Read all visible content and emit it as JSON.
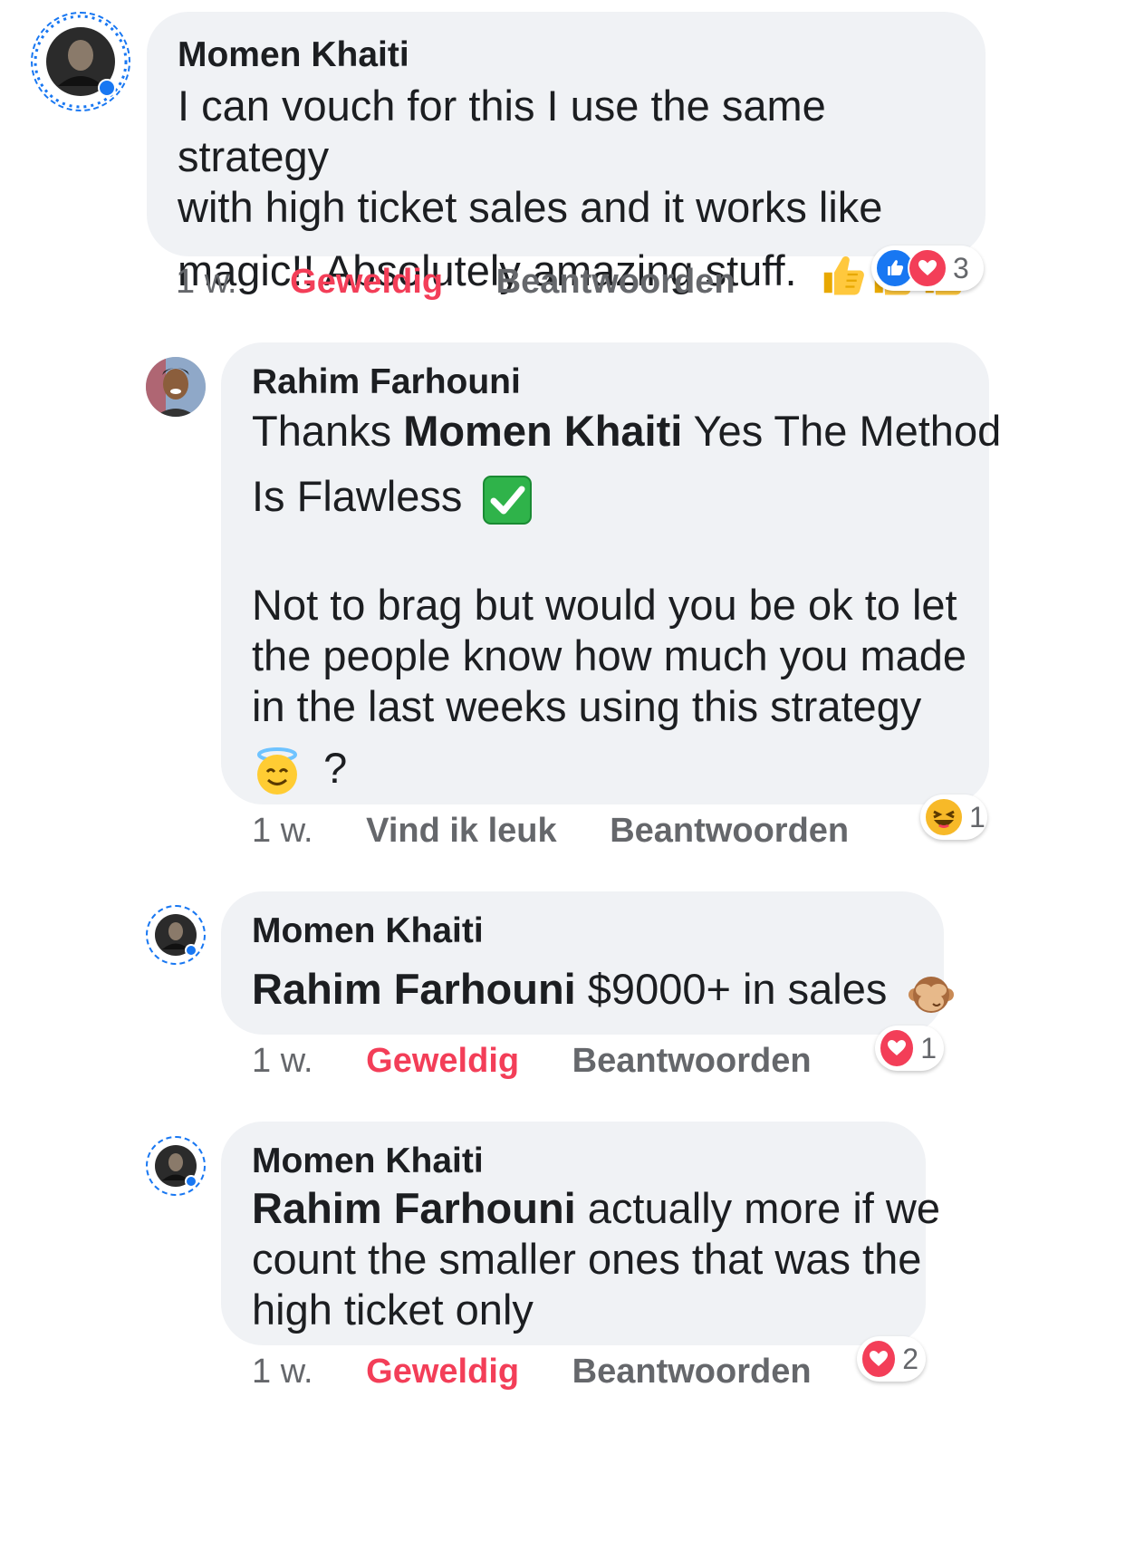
{
  "comments": [
    {
      "author": "Momen Khaiti",
      "lines": [
        "I can vouch for this I use the same strategy",
        "with high ticket sales and it works like",
        "magic!! Absolutely amazing stuff."
      ],
      "emoji": [
        "thumbs-up-emoji",
        "thumbs-up-emoji",
        "thumbs-up-emoji"
      ],
      "time": "1 w.",
      "reaction_label": "Geweldig",
      "reply_label": "Beantwoorden",
      "reaction_summary": {
        "icons": [
          "like-icon",
          "love-icon"
        ],
        "count": "3"
      }
    },
    {
      "author": "Rahim Farhouni",
      "text_pre": "Thanks ",
      "mention": "Momen Khaiti",
      "text_post": " Yes The Method",
      "line2": "Is Flawless",
      "line2_emoji": "check-mark-emoji",
      "para2": [
        "Not to brag but would you be ok to let",
        "the people know how much you made",
        "in the last weeks using this strategy"
      ],
      "para2_end": "?",
      "para2_emoji": "smiling-halo-emoji",
      "time": "1 w.",
      "reaction_label": "Vind ik leuk",
      "reply_label": "Beantwoorden",
      "reaction_summary": {
        "icons": [
          "haha-icon"
        ],
        "count": "1"
      }
    },
    {
      "author": "Momen Khaiti",
      "mention": "Rahim Farhouni",
      "text": " $9000+ in sales",
      "emoji": "see-no-evil-monkey-emoji",
      "time": "1 w.",
      "reaction_label": "Geweldig",
      "reply_label": "Beantwoorden",
      "reaction_summary": {
        "icons": [
          "love-icon"
        ],
        "count": "1"
      }
    },
    {
      "author": "Momen Khaiti",
      "mention": "Rahim Farhouni",
      "line1_post": " actually more if we",
      "lines": [
        "count the smaller ones that was the",
        "high ticket only"
      ],
      "time": "1 w.",
      "reaction_label": "Geweldig",
      "reply_label": "Beantwoorden",
      "reaction_summary": {
        "icons": [
          "love-icon"
        ],
        "count": "2"
      }
    }
  ],
  "colors": {
    "bubble": "#f0f2f5",
    "love": "#f33e58",
    "like": "#1877f2",
    "secondary_text": "#65676b"
  }
}
